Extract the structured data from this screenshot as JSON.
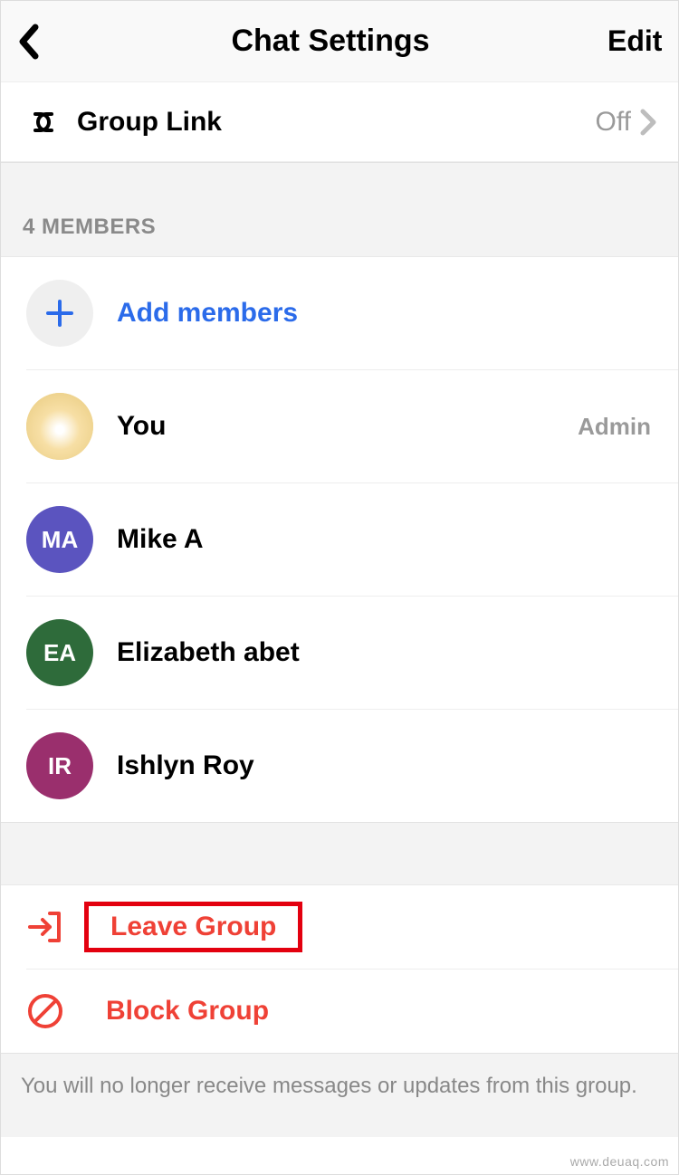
{
  "header": {
    "title": "Chat Settings",
    "edit_label": "Edit"
  },
  "group_link": {
    "label": "Group Link",
    "value": "Off"
  },
  "members_section": {
    "title": "4 MEMBERS",
    "add_label": "Add members",
    "items": [
      {
        "name": "You",
        "role": "Admin",
        "initials": "",
        "color": "#f2d996"
      },
      {
        "name": "Mike A",
        "role": "",
        "initials": "MA",
        "color": "#5b54bf"
      },
      {
        "name": "Elizabeth abet",
        "role": "",
        "initials": "EA",
        "color": "#2e6b3a"
      },
      {
        "name": "Ishlyn Roy",
        "role": "",
        "initials": "IR",
        "color": "#9a2f6d"
      }
    ]
  },
  "actions": {
    "leave_label": "Leave Group",
    "block_label": "Block Group"
  },
  "footer": {
    "text": "You will no longer receive messages or updates from this group."
  },
  "watermark": "www.deuaq.com"
}
